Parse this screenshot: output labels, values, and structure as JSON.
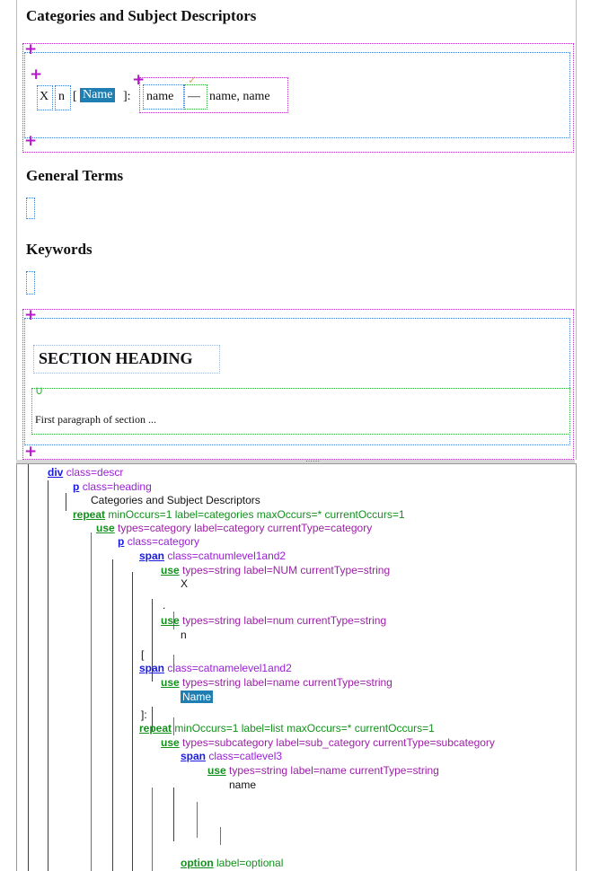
{
  "editor": {
    "heading_categories": "Categories and Subject Descriptors",
    "heading_general": "General Terms",
    "heading_keywords": "Keywords",
    "section_heading": "SECTION HEADING",
    "first_paragraph": "First paragraph of section ...",
    "cat_x": "X",
    "cat_n": "n",
    "cat_open": "[",
    "cat_name": "Name",
    "cat_close": "]:",
    "sub_name": "name",
    "dash": "—",
    "sub_name_list": "name, name"
  },
  "tree": [
    {
      "kw": "div",
      "attrs": "class=descr"
    },
    {
      "kw": "p",
      "attrs": "class=heading"
    },
    {
      "text": "Categories and Subject Descriptors"
    },
    {
      "kw": "repeat",
      "attrs": "minOccurs=1 label=categories maxOccurs=* currentOccurs=1"
    },
    {
      "kw": "use",
      "attrs": "types=category label=category currentType=category"
    },
    {
      "kw": "p",
      "attrs": "class=category"
    },
    {
      "kw": "span",
      "attrs": "class=catnumlevel1and2"
    },
    {
      "kw": "use",
      "attrs": "types=string label=NUM currentType=string"
    },
    {
      "text": "X"
    },
    {
      "text": "."
    },
    {
      "kw": "use",
      "attrs": "types=string label=num currentType=string"
    },
    {
      "text": "n"
    },
    {
      "text": "["
    },
    {
      "kw": "span",
      "attrs": "class=catnamelevel1and2"
    },
    {
      "kw": "use",
      "attrs": "types=string label=name currentType=string"
    },
    {
      "text": "Name"
    },
    {
      "text": "]:"
    },
    {
      "kw": "repeat",
      "attrs": "minOccurs=1 label=list maxOccurs=* currentOccurs=1"
    },
    {
      "kw": "use",
      "attrs": "types=subcategory label=sub_category currentType=subcategory"
    },
    {
      "kw": "span",
      "attrs": "class=catlevel3"
    },
    {
      "kw": "use",
      "attrs": "types=string label=name currentType=string"
    },
    {
      "text": "name"
    },
    {
      "kw": "option",
      "attrs": "label=optional"
    }
  ],
  "colors": {
    "accent": "#1f7fb2",
    "magenta": "#c02bc9",
    "blue_line": "#2b2bd9",
    "green_line": "#2a9e30"
  }
}
